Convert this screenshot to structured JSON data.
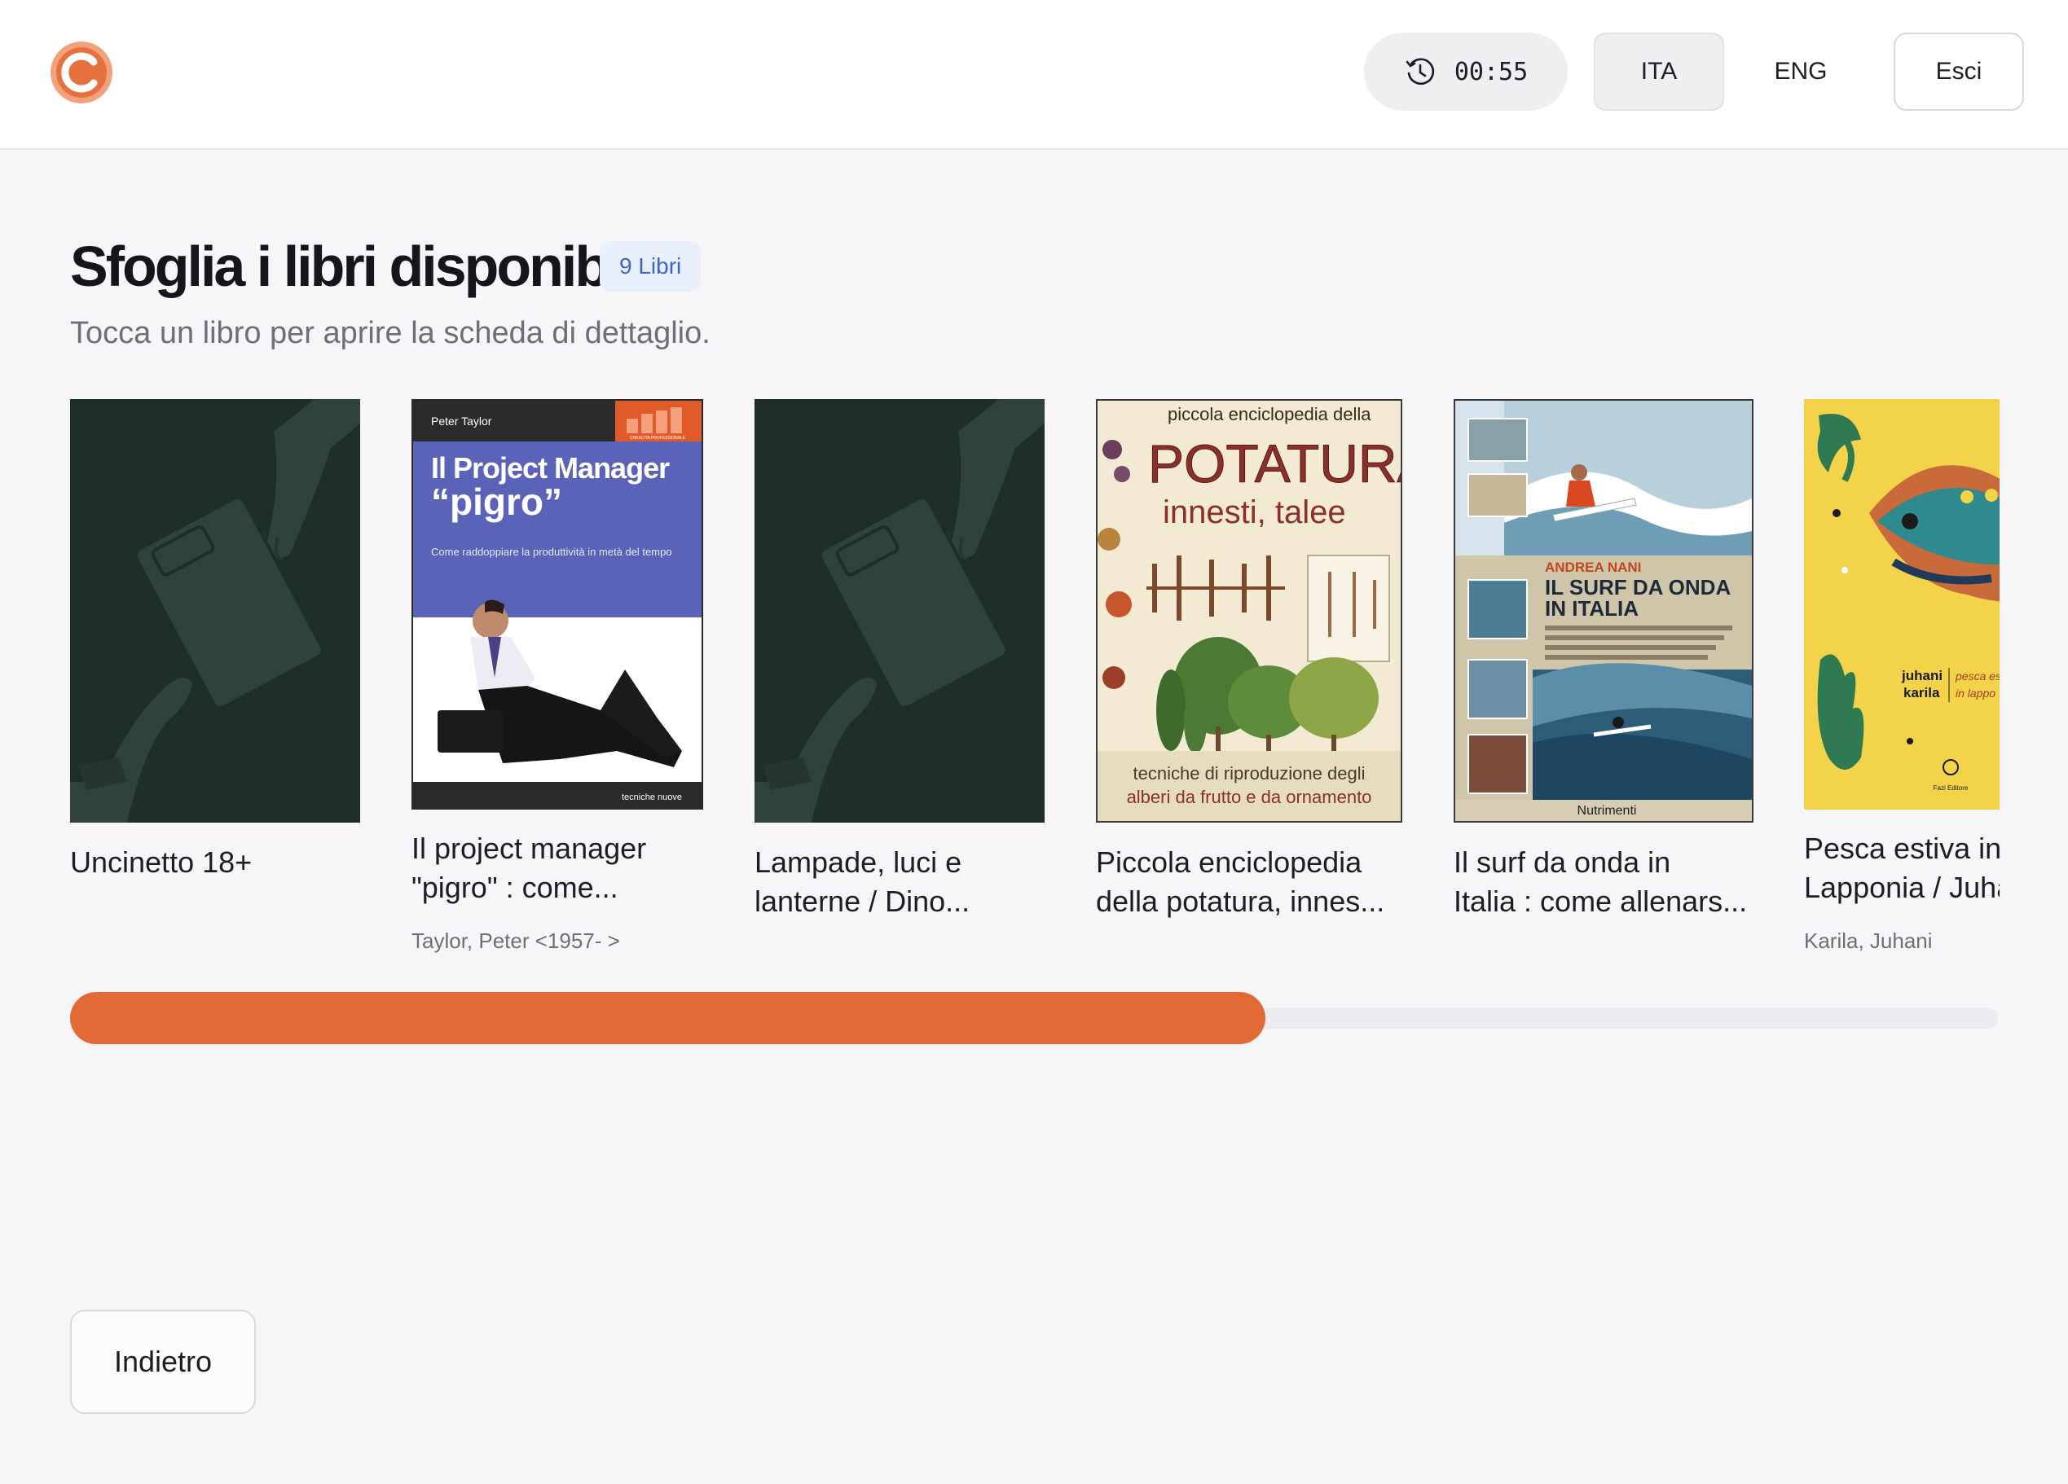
{
  "header": {
    "timer": "00:55",
    "lang_ita": "ITA",
    "lang_eng": "ENG",
    "exit_label": "Esci",
    "brand_color": "#e26a37"
  },
  "main": {
    "title": "Sfoglia i libri disponibili",
    "count_badge": "9 Libri",
    "subtitle": "Tocca un libro per aprire la scheda di dettaglio."
  },
  "books": [
    {
      "title_line1": "Uncinetto 18+",
      "title_line2": "",
      "author": "",
      "cover": "placeholder-cover"
    },
    {
      "title_line1": "Il project manager",
      "title_line2": "\"pigro\" : come...",
      "author": "Taylor, Peter <1957- >",
      "cover": "project-manager-cover",
      "cover_text": {
        "author": "Peter Taylor",
        "title1": "Il Project Manager",
        "title2": "“pigro”",
        "tagline": "Come raddoppiare la produttività in metà del tempo",
        "badge": "CRESCITA PROFESSIONALE",
        "publisher": "tecniche nuove"
      }
    },
    {
      "title_line1": "Lampade, luci e",
      "title_line2": "lanterne / Dino...",
      "author": "",
      "cover": "placeholder-cover"
    },
    {
      "title_line1": "Piccola enciclopedia",
      "title_line2": "della potatura, innes...",
      "author": "",
      "cover": "potatura-cover",
      "cover_text": {
        "top": "piccola enciclopedia della",
        "title1": "POTATURA",
        "title2": "innesti, talee",
        "bottom1": "tecniche di riproduzione degli",
        "bottom2": "alberi da frutto e da ornamento"
      }
    },
    {
      "title_line1": "Il surf da onda in",
      "title_line2": "Italia : come allenars...",
      "author": "",
      "cover": "surf-cover",
      "cover_text": {
        "author": "ANDREA NANI",
        "title1": "IL SURF DA ONDA",
        "title2": "IN ITALIA",
        "publisher": "Nutrimenti"
      }
    },
    {
      "title_line1": "Pesca estiva in",
      "title_line2": "Lapponia / Juhani",
      "author": "Karila, Juhani",
      "cover": "pesca-cover",
      "cover_text": {
        "author1": "juhani",
        "author2": "karila",
        "title1": "pesca es",
        "title2": "in lappo",
        "publisher": "Fazi Editore"
      }
    }
  ],
  "progress": {
    "value": 0.62
  },
  "footer": {
    "back_label": "Indietro"
  }
}
